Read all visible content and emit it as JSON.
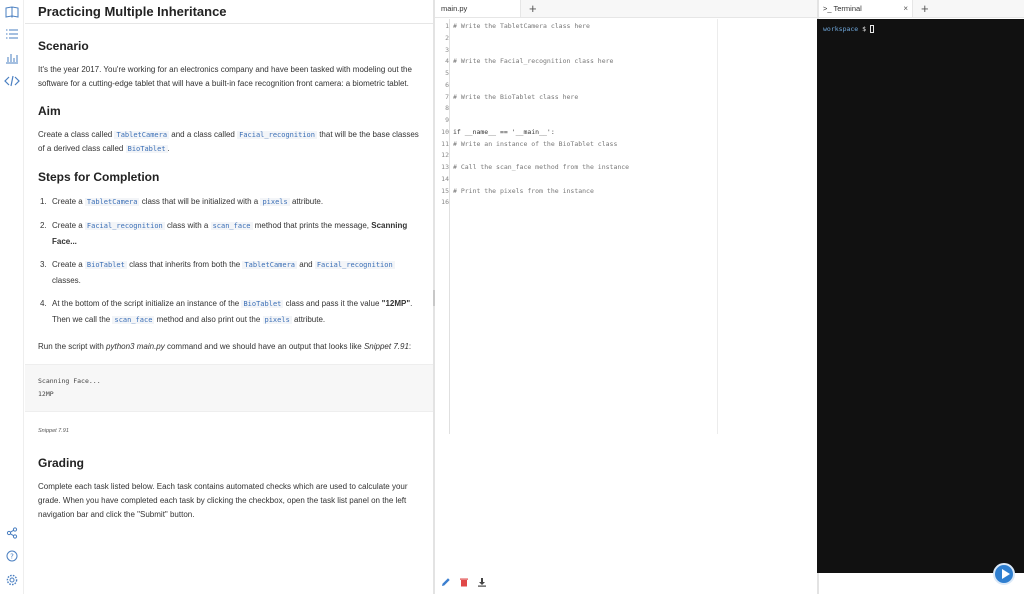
{
  "guide": {
    "title": "Practicing Multiple Inheritance",
    "scenario_heading": "Scenario",
    "scenario_text": "It's the year 2017. You're working for an electronics company and have been tasked with modeling out the software for a cutting-edge tablet that will have a built-in face recognition front camera: a biometric tablet.",
    "aim_heading": "Aim",
    "aim": {
      "t1": "Create a class called ",
      "c1": "TabletCamera",
      "t2": " and a class called ",
      "c2": "Facial_recognition",
      "t3": " that will be the base classes of a derived class called ",
      "c3": "BioTablet",
      "t4": "."
    },
    "steps_heading": "Steps for Completion",
    "steps": [
      {
        "num": "1.",
        "a": "Create a ",
        "c1": "TabletCamera",
        "b": " class that will be initialized with a ",
        "c2": "pixels",
        "d": " attribute."
      },
      {
        "num": "2.",
        "a": "Create a ",
        "c1": "Facial_recognition",
        "b": " class with a ",
        "c2": "scan_face",
        "d": " method that prints the message, ",
        "strong": "Scanning Face..."
      },
      {
        "num": "3.",
        "a": "Create a ",
        "c1": "BioTablet",
        "b": " class that inherits from both the ",
        "c2": "TabletCamera",
        "d": " and ",
        "c3": "Facial_recognition",
        "e": " classes."
      },
      {
        "num": "4.",
        "a": "At the bottom of the script initialize an instance of the ",
        "c1": "BioTablet",
        "b": " class and pass it the value ",
        "strong": "\"12MP\"",
        "d": ". Then we call the ",
        "c2": "scan_face",
        "e": " method and also print out the ",
        "c3": "pixels",
        "f": " attribute."
      }
    ],
    "run": {
      "t1": "Run the script with ",
      "em1": "python3 main.py",
      "t2": " command and we should have an output that looks like ",
      "em2": "Snippet 7.91",
      "t3": ":"
    },
    "snippet_lines": [
      "Scanning Face...",
      "12MP"
    ],
    "snippet_caption": "Snippet 7.91",
    "grading_heading": "Grading",
    "grading_text": "Complete each task listed below. Each task contains automated checks which are used to calculate your grade. When you have completed each task by clicking the checkbox, open the task list panel on the left navigation bar and click the \"Submit\" button."
  },
  "rail_icons": [
    "book-icon",
    "task-list-icon",
    "bar-chart-icon",
    "code-icon",
    "share-icon",
    "help-icon",
    "settings-icon"
  ],
  "editor": {
    "tab_label": "main.py",
    "add_tab": "+",
    "line_numbers": [
      "1",
      "2",
      "3",
      "4",
      "5",
      "6",
      "7",
      "8",
      "9",
      "10",
      "11",
      "12",
      "13",
      "14",
      "15",
      "16"
    ],
    "lines": [
      {
        "type": "cm",
        "text": "# Write the TabletCamera class here"
      },
      {
        "type": "plain",
        "text": ""
      },
      {
        "type": "plain",
        "text": ""
      },
      {
        "type": "cm",
        "text": "# Write the Facial_recognition class here"
      },
      {
        "type": "plain",
        "text": ""
      },
      {
        "type": "plain",
        "text": ""
      },
      {
        "type": "cm",
        "text": "# Write the BioTablet class here"
      },
      {
        "type": "plain",
        "text": ""
      },
      {
        "type": "plain",
        "text": ""
      },
      {
        "type": "main",
        "text": "if __name__ == '__main__':"
      },
      {
        "type": "cm",
        "text": "# Write an instance of the BioTablet class"
      },
      {
        "type": "plain",
        "text": ""
      },
      {
        "type": "cm",
        "text": "# Call the scan_face method from the instance"
      },
      {
        "type": "plain",
        "text": ""
      },
      {
        "type": "cm",
        "text": "# Print the pixels from the instance"
      },
      {
        "type": "plain",
        "text": ""
      }
    ]
  },
  "terminal": {
    "tab_label": ">_ Terminal",
    "close": "×",
    "add_tab": "+",
    "prompt": "workspace",
    "prompt_symbol": "$"
  }
}
